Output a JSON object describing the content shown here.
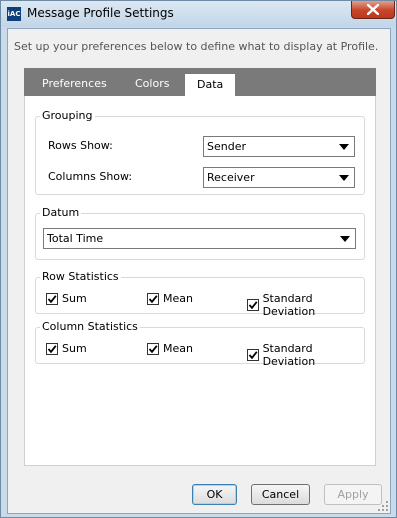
{
  "window": {
    "title": "Message Profile Settings",
    "icon_label": "iAC"
  },
  "intro_text": "Set up your preferences below to define what to display at Profile.",
  "tabs": [
    {
      "label": "Preferences",
      "active": false
    },
    {
      "label": "Colors",
      "active": false
    },
    {
      "label": "Data",
      "active": true
    }
  ],
  "grouping": {
    "legend": "Grouping",
    "rows_label": "Rows Show:",
    "rows_value": "Sender",
    "columns_label": "Columns Show:",
    "columns_value": "Receiver"
  },
  "datum": {
    "legend": "Datum",
    "value": "Total Time"
  },
  "row_statistics": {
    "legend": "Row Statistics",
    "items": [
      {
        "label": "Sum",
        "checked": true
      },
      {
        "label": "Mean",
        "checked": true
      },
      {
        "label": "Standard Deviation",
        "checked": true
      }
    ]
  },
  "column_statistics": {
    "legend": "Column Statistics",
    "items": [
      {
        "label": "Sum",
        "checked": true
      },
      {
        "label": "Mean",
        "checked": true
      },
      {
        "label": "Standard Deviation",
        "checked": true
      }
    ]
  },
  "buttons": {
    "ok": "OK",
    "cancel": "Cancel",
    "apply": "Apply"
  }
}
